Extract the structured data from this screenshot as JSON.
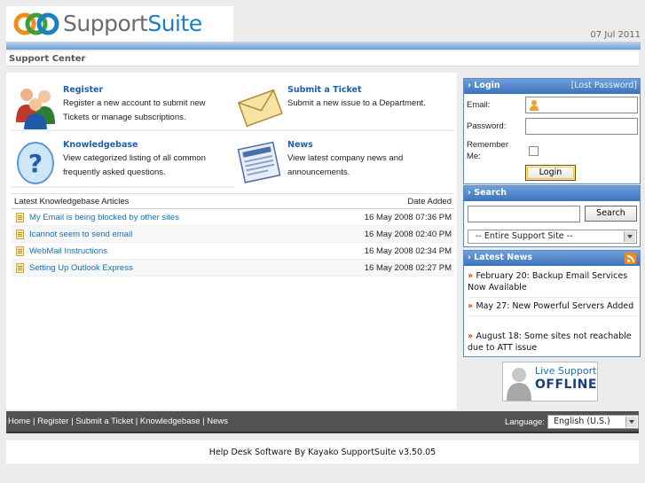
{
  "header": {
    "logo_part1": "Support",
    "logo_part2": "Suite",
    "date": "07 Jul 2011"
  },
  "page_title": "Support Center",
  "features": [
    {
      "title": "Register",
      "desc": "Register a new account to submit new Tickets or manage subscriptions."
    },
    {
      "title": "Submit a Ticket",
      "desc": "Submit a new issue to a Department."
    },
    {
      "title": "Knowledgebase",
      "desc": "View categorized listing of all common frequently asked questions."
    },
    {
      "title": "News",
      "desc": "View latest company news and announcements."
    }
  ],
  "kb": {
    "heading": "Latest Knowledgebase Articles",
    "date_heading": "Date Added",
    "rows": [
      {
        "title": "My Email is being blocked by other sites",
        "date": "16 May 2008 07:36 PM"
      },
      {
        "title": "Icannot seem to send email",
        "date": "16 May 2008 02:40 PM"
      },
      {
        "title": "WebMail Instructions",
        "date": "16 May 2008 02:34 PM"
      },
      {
        "title": "Setting Up Outlook Express",
        "date": "16 May 2008 02:27 PM"
      }
    ]
  },
  "login": {
    "heading": "Login",
    "lost_password": "[Lost Password]",
    "email_label": "Email:",
    "password_label": "Password:",
    "remember_label": "Remember Me:",
    "button": "Login"
  },
  "search": {
    "heading": "Search",
    "button": "Search",
    "scope": "-- Entire Support Site --"
  },
  "news": {
    "heading": "Latest News",
    "items": [
      {
        "text": "February 20: Backup Email Services Now Available"
      },
      {
        "text": "May 27: New Powerful Servers Added"
      },
      {
        "text": "August 18: Some sites not reachable due to ATT issue"
      }
    ]
  },
  "live_support": {
    "line1": "Live Support",
    "line2": "OFFLINE"
  },
  "footer": {
    "links": [
      "Home",
      "Register",
      "Submit a Ticket",
      "Knowledgebase",
      "News"
    ],
    "language_label": "Language:",
    "language_value": "English (U.S.)"
  },
  "powered_by": "Help Desk Software By Kayako SupportSuite v3.50.05",
  "colors": {
    "accent_blue": "#1a6fb8",
    "header_bar": "#3c72ba",
    "footer_bg": "#525252",
    "news_bullet": "#d04010"
  }
}
